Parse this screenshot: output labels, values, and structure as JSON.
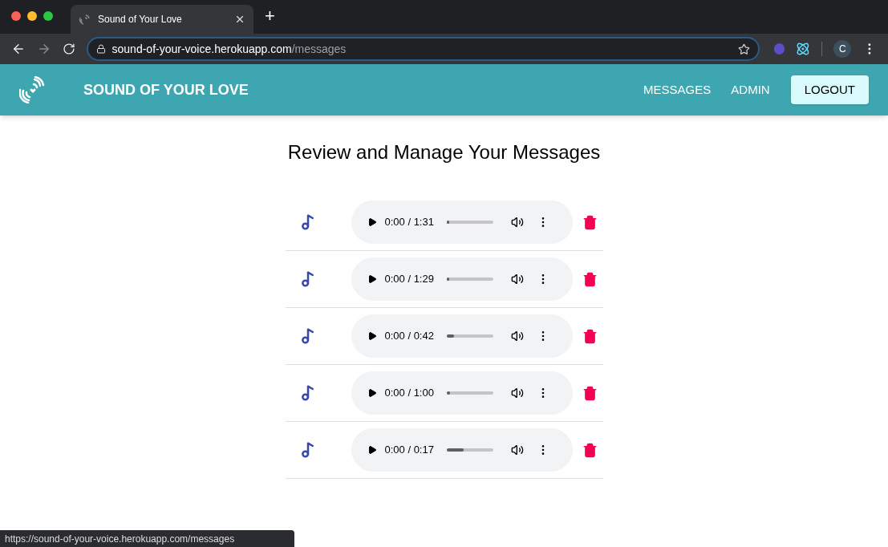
{
  "browser": {
    "tab": {
      "title": "Sound of Your Love",
      "selected": true
    },
    "new_tab": "+",
    "url_host": "sound-of-your-voice.herokuapp.com",
    "url_path": "/messages",
    "profile": "C"
  },
  "navbar": {
    "brand": "SOUND OF YOUR LOVE",
    "links": [
      "MESSAGES",
      "ADMIN"
    ],
    "logout": "LOGOUT"
  },
  "page": {
    "title": "Review and Manage Your Messages"
  },
  "messages": [
    {
      "time": "0:00 / 1:31",
      "level": 0.05
    },
    {
      "time": "0:00 / 1:29",
      "level": 0.05
    },
    {
      "time": "0:00 / 0:42",
      "level": 0.15
    },
    {
      "time": "0:00 / 1:00",
      "level": 0.07
    },
    {
      "time": "0:00 / 0:17",
      "level": 0.37
    }
  ],
  "status_bar": {
    "url": "https://sound-of-your-voice.herokuapp.com/messages"
  }
}
